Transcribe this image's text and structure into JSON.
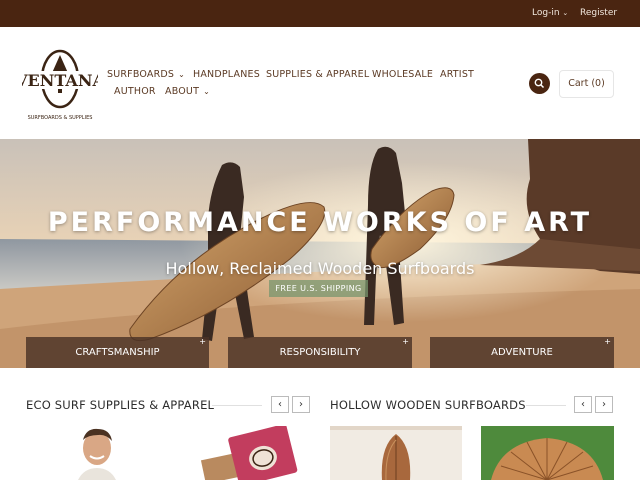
{
  "topbar": {
    "login": "Log-in",
    "register": "Register"
  },
  "logo": {
    "wordmark": "VENTANA",
    "tagline": "SURFBOARDS & SUPPLIES"
  },
  "nav": {
    "surfboards": "SURFBOARDS",
    "handplanes": "HANDPLANES",
    "supplies": "SUPPLIES & APPAREL",
    "wholesale": "WHOLESALE",
    "artist": "ARTIST",
    "author": "AUTHOR",
    "about": "ABOUT"
  },
  "header_actions": {
    "search_icon": "search-icon",
    "cart": "Cart (0)"
  },
  "hero": {
    "title": "PERFORMANCE WORKS OF ART",
    "subtitle": "Hollow, Reclaimed Wooden Surfboards",
    "badge": "FREE U.S. SHIPPING",
    "tiles": [
      "CRAFTSMANSHIP",
      "RESPONSIBILITY",
      "ADVENTURE"
    ]
  },
  "sections": {
    "supplies": {
      "title": "ECO SURF SUPPLIES & APPAREL"
    },
    "boards": {
      "title": "HOLLOW WOODEN SURFBOARDS"
    }
  },
  "colors": {
    "brand_brown": "#4a2511",
    "nav_text": "#5b3a24",
    "badge_green": "#7f9a72"
  }
}
